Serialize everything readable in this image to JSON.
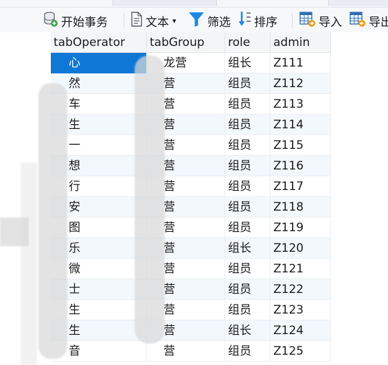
{
  "toolbar": {
    "items": [
      {
        "label": "开始事务",
        "icon": "database-transaction-icon"
      },
      {
        "label": "文本",
        "icon": "document-text-icon",
        "dropdown": "▾"
      },
      {
        "label": "筛选",
        "icon": "filter-funnel-icon"
      },
      {
        "label": "排序",
        "icon": "sort-arrows-icon"
      },
      {
        "label": "导入",
        "icon": "import-table-icon"
      },
      {
        "label": "导出",
        "icon": "export-table-icon"
      }
    ]
  },
  "table": {
    "columns": [
      "tabOperator",
      "tabGroup",
      "role",
      "admin"
    ],
    "rows": [
      {
        "operator": "心",
        "group": "龙营",
        "role": "组长",
        "admin": "Z111"
      },
      {
        "operator": "然",
        "group": "营",
        "role": "组员",
        "admin": "Z112"
      },
      {
        "operator": "车",
        "group": "营",
        "role": "组员",
        "admin": "Z113"
      },
      {
        "operator": "生",
        "group": "营",
        "role": "组员",
        "admin": "Z114"
      },
      {
        "operator": "一",
        "group": "营",
        "role": "组员",
        "admin": "Z115"
      },
      {
        "operator": "想",
        "group": "营",
        "role": "组员",
        "admin": "Z116"
      },
      {
        "operator": "行",
        "group": "营",
        "role": "组员",
        "admin": "Z117"
      },
      {
        "operator": "安",
        "group": "营",
        "role": "组员",
        "admin": "Z118"
      },
      {
        "operator": "图",
        "group": "营",
        "role": "组员",
        "admin": "Z119"
      },
      {
        "operator": "乐",
        "group": "营",
        "role": "组长",
        "admin": "Z120"
      },
      {
        "operator": "微",
        "group": "营",
        "role": "组员",
        "admin": "Z121"
      },
      {
        "operator": "士",
        "group": "营",
        "role": "组员",
        "admin": "Z122"
      },
      {
        "operator": "生",
        "group": "营",
        "role": "组员",
        "admin": "Z123"
      },
      {
        "operator": "生",
        "group": "营",
        "role": "组长",
        "admin": "Z124"
      },
      {
        "operator": "音",
        "group": "营",
        "role": "组员",
        "admin": "Z125"
      }
    ],
    "selected_row": 0
  },
  "colors": {
    "selection": "#0f78d7",
    "alt_row": "#f3f8fd",
    "header_bg": "#f4f5f7",
    "filter_icon": "#1e88e5"
  }
}
